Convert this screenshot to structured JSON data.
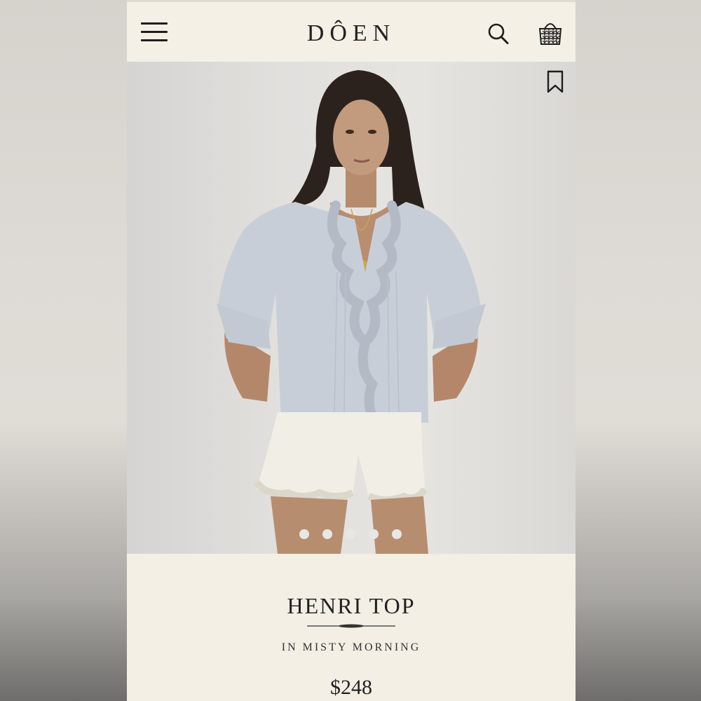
{
  "header": {
    "logo": "DÔEN",
    "menu_icon": "hamburger-menu-icon",
    "search_icon": "search-icon",
    "bag_icon": "shopping-basket-icon"
  },
  "hero": {
    "bookmark_icon": "bookmark-icon",
    "carousel": {
      "total": 5,
      "active": 1
    }
  },
  "product": {
    "name": "HENRI TOP",
    "color": "IN MISTY MORNING",
    "price": "$248"
  },
  "colors": {
    "page_bg": "#f3efe5",
    "text": "#222222",
    "hero_bg": "#e2e0dd",
    "blouse": "#c9cfd8",
    "shorts": "#f2efe7"
  }
}
